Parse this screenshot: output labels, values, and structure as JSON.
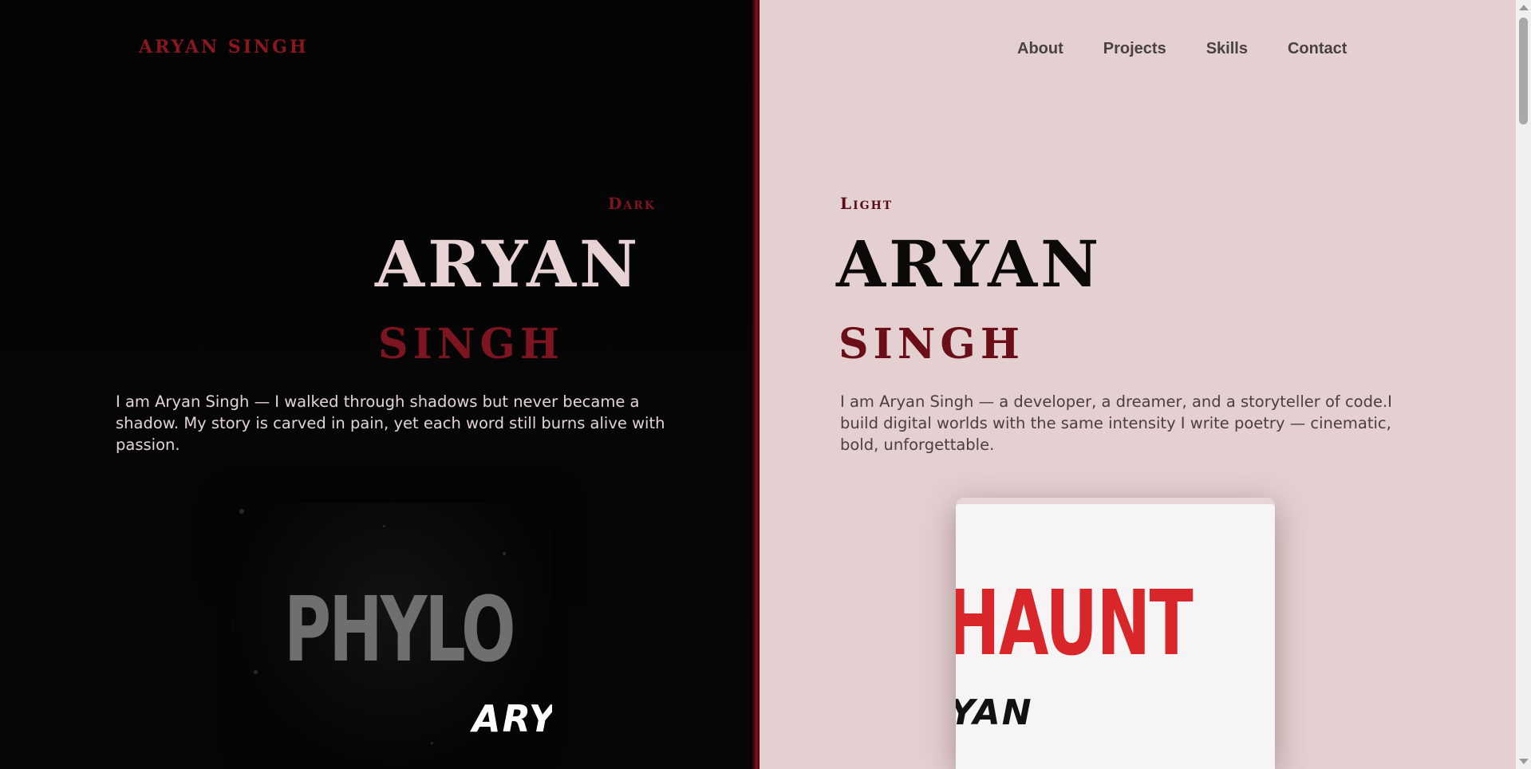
{
  "brand": {
    "name": "ARYAN SINGH"
  },
  "nav": {
    "items": [
      {
        "label": "About"
      },
      {
        "label": "Projects"
      },
      {
        "label": "Skills"
      },
      {
        "label": "Contact"
      }
    ]
  },
  "dark": {
    "mode_label": "Dark",
    "first_name": "ARYAN",
    "last_name": "SINGH",
    "description": "I am Aryan Singh — I walked through shadows but never became a shadow. My story is carved in pain, yet each word still burns alive with passion.",
    "cover": {
      "title": "PHYLO",
      "author": "ARY"
    }
  },
  "light": {
    "mode_label": "Light",
    "first_name": "ARYAN",
    "last_name": "SINGH",
    "description": "I am Aryan Singh — a developer, a dreamer, and a storyteller of code.I build digital worlds with the same intensity I write poetry — cinematic, bold, unforgettable.",
    "cover": {
      "title": "HAUNT",
      "author": "YAN"
    }
  },
  "colors": {
    "accent": "#7d1520",
    "dark_bg": "#060506",
    "light_bg": "#e4d0d1",
    "cover_red": "#d9262a"
  }
}
